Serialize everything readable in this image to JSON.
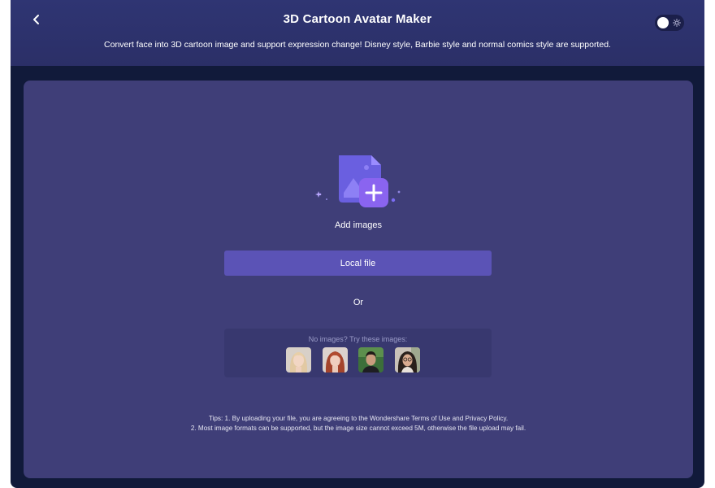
{
  "header": {
    "title": "3D Cartoon Avatar Maker",
    "subtitle": "Convert face into 3D cartoon image and support expression change! Disney style, Barbie style and normal comics style are supported.",
    "back_icon": "chevron-left-icon",
    "theme_toggle_icon": "sun-icon"
  },
  "upload": {
    "add_images_label": "Add images",
    "local_file_label": "Local file",
    "or_label": "Or"
  },
  "samples": {
    "label": "No images?  Try these images:",
    "items": [
      "sample-face-1",
      "sample-face-2",
      "sample-face-3",
      "sample-face-4"
    ]
  },
  "tips": {
    "line1": "Tips: 1. By uploading your file, you are agreeing to the Wondershare Terms of Use and Privacy Policy.",
    "line2": "2. Most image formats can be supported, but the image size cannot exceed 5M, otherwise the file upload may fail."
  },
  "colors": {
    "header_bg": "#2f3573",
    "panel_bg": "#3f3e78",
    "button_bg": "#5b53b6",
    "accent_purple": "#7b6cf2"
  }
}
